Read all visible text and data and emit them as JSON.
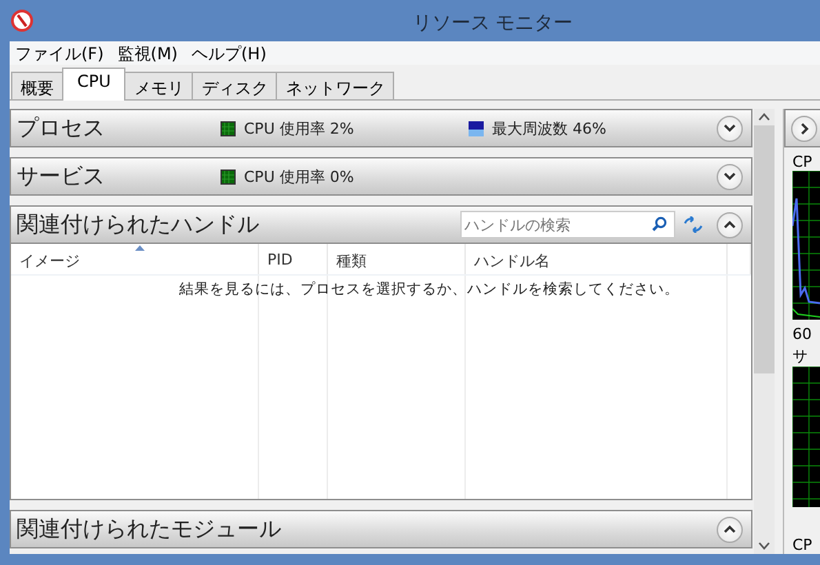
{
  "window": {
    "title": "リソース モニター"
  },
  "menu": [
    "ファイル(F)",
    "監視(M)",
    "ヘルプ(H)"
  ],
  "tabs": [
    {
      "label": "概要",
      "selected": false
    },
    {
      "label": "CPU",
      "selected": true
    },
    {
      "label": "メモリ",
      "selected": false
    },
    {
      "label": "ディスク",
      "selected": false
    },
    {
      "label": "ネットワーク",
      "selected": false
    }
  ],
  "sections": [
    {
      "title": "プロセス",
      "expanded": false,
      "stats": [
        {
          "kind": "usage",
          "label": "CPU 使用率 2%"
        },
        {
          "kind": "frequency",
          "label": "最大周波数 46%"
        }
      ]
    },
    {
      "title": "サービス",
      "expanded": false,
      "stats": [
        {
          "kind": "usage",
          "label": "CPU 使用率 0%"
        }
      ]
    },
    {
      "title": "関連付けられたハンドル",
      "expanded": true,
      "search": {
        "placeholder": "ハンドルの検索"
      },
      "columns": [
        "イメージ",
        "PID",
        "種類",
        "ハンドル名"
      ],
      "message": "結果を見るには、プロセスを選択するか、ハンドルを検索してください。"
    },
    {
      "title": "関連付けられたモジュール",
      "expanded": true
    }
  ],
  "side_panel": {
    "labels": [
      "CP",
      "60",
      "サ",
      "CP"
    ]
  }
}
